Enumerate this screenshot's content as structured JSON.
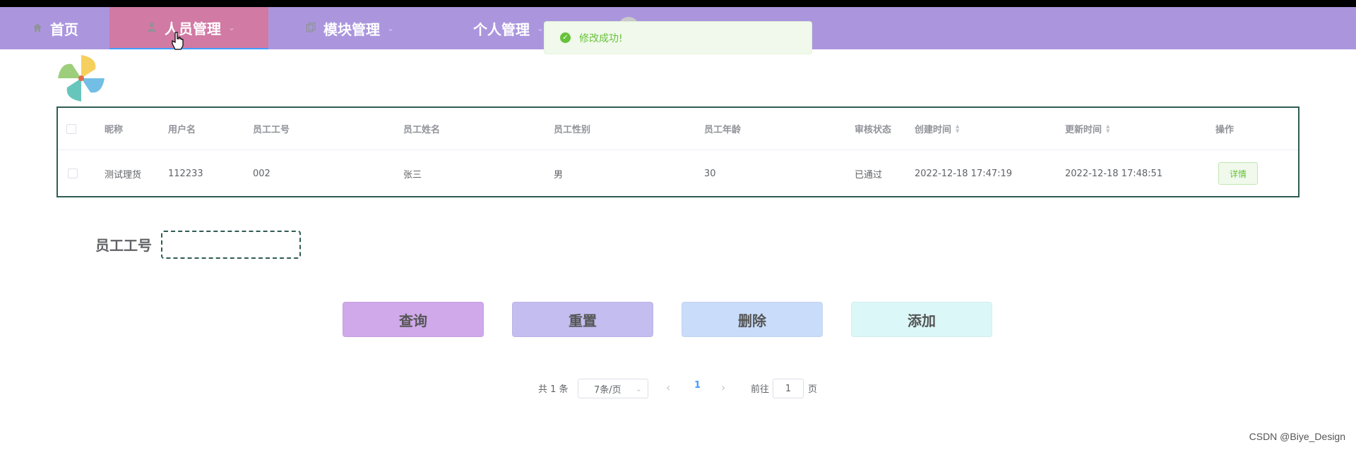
{
  "nav": {
    "items": [
      {
        "label": "首页",
        "icon": "home-icon"
      },
      {
        "label": "人员管理",
        "icon": "user-icon",
        "active": true
      },
      {
        "label": "模块管理",
        "icon": "copy-icon"
      },
      {
        "label": "个人管理",
        "icon": ""
      }
    ],
    "bg_color": "#ab96de",
    "active_color": "#d17aa3"
  },
  "toast": {
    "message": "修改成功!",
    "icon": "success-check-icon"
  },
  "table": {
    "headers": [
      "昵称",
      "用户名",
      "员工工号",
      "员工姓名",
      "员工性别",
      "员工年龄",
      "审核状态",
      "创建时间",
      "更新时间",
      "操作"
    ],
    "rows": [
      {
        "nickname": "测试理货",
        "username": "112233",
        "emp_no": "002",
        "name": "张三",
        "gender": "男",
        "age": "30",
        "status": "已通过",
        "created": "2022-12-18 17:47:19",
        "updated": "2022-12-18 17:48:51",
        "action": "详情"
      }
    ]
  },
  "search": {
    "label": "员工工号",
    "value": ""
  },
  "buttons": {
    "query": {
      "label": "查询",
      "color": "#cfa9ea"
    },
    "reset": {
      "label": "重置",
      "color": "#c3bdf0"
    },
    "delete": {
      "label": "删除",
      "color": "#c9ddfa"
    },
    "add": {
      "label": "添加",
      "color": "#dcf7f8"
    }
  },
  "pagination": {
    "total": "共 1 条",
    "page_size": "7条/页",
    "current": "1",
    "goto_label": "前往",
    "goto_value": "1",
    "page_suffix": "页"
  },
  "watermark": "CSDN @Biye_Design"
}
